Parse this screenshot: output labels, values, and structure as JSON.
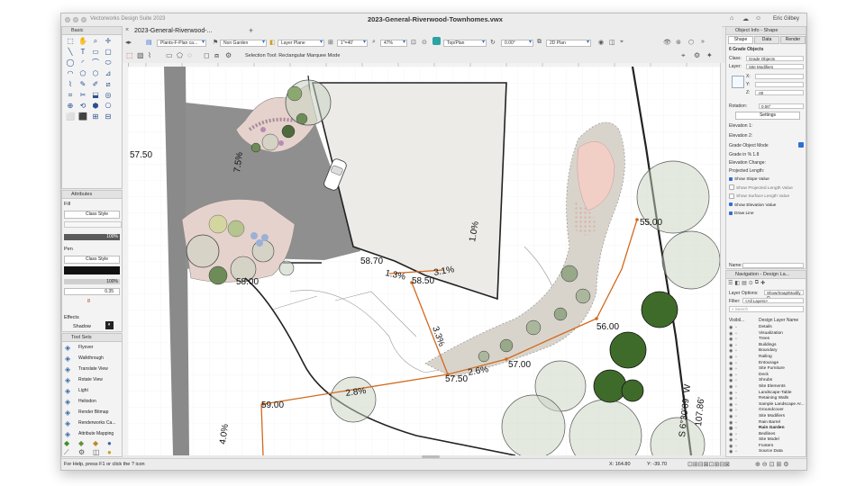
{
  "app": {
    "name": "Vectorworks Design Suite 2023",
    "document_title": "2023-General-Riverwood-Townhomes.vwx",
    "user": "Eric Gilbey",
    "doc_tab": "2023-General-Riverwood-..."
  },
  "toolbar": {
    "view_combo": "Plants-F-Plan ca...",
    "class_combo": "Non Garden",
    "layer_combo": "Layer Plane",
    "scale_combo": "1\"=40'",
    "zoom_combo": "47%",
    "view_mode": "Top/Plan",
    "angle": "0.00°",
    "render_mode": "2D Plan",
    "mode_text": "Selection Tool: Rectangular Marquee Mode"
  },
  "basic_palette": {
    "title": "Basic",
    "tools": [
      "⬚",
      "✋",
      "⌕",
      "✛",
      "╲",
      "T",
      "▭",
      "▢",
      "◯",
      "◜",
      "⌒",
      "⬭",
      "◠",
      "⬠",
      "⬡",
      "⊿",
      "⌇",
      "✎",
      "✐",
      "⧄",
      "⌗",
      "✂",
      "⬓",
      "◎",
      "⊕",
      "⟲",
      "⬢",
      "⎔",
      "⬜",
      "⬛",
      "⊞",
      "⊟"
    ]
  },
  "attributes": {
    "title": "Attributes",
    "fill_label": "Fill",
    "fill_value": "Class Style",
    "fill_opacity": "100%",
    "pen_label": "Pen",
    "pen_value": "Class Style",
    "pen_opacity": "100%",
    "line_weight": "0.35",
    "effects_label": "Effects",
    "shadow_label": "Shadow"
  },
  "tool_sets": {
    "title": "Tool Sets",
    "items": [
      {
        "label": "Flyover",
        "icon": "flyover-icon"
      },
      {
        "label": "Walkthrough",
        "icon": "walkthrough-icon"
      },
      {
        "label": "Translate View",
        "icon": "translate-icon"
      },
      {
        "label": "Rotate View",
        "icon": "rotate-icon"
      },
      {
        "label": "Light",
        "icon": "light-icon"
      },
      {
        "label": "Heliodon",
        "icon": "heliodon-icon"
      },
      {
        "label": "Render Bitmap",
        "icon": "bitmap-icon"
      },
      {
        "label": "Renderworks Ca...",
        "icon": "camera-icon"
      },
      {
        "label": "Attribute Mapping",
        "icon": "mapping-icon"
      }
    ]
  },
  "object_info": {
    "title": "Object Info - Shape",
    "tabs": [
      "Shape",
      "Data",
      "Render"
    ],
    "object_type": "6 Grade Objects",
    "class_label": "Class:",
    "class_value": "Grade Objects",
    "layer_label": "Layer:",
    "layer_value": "Site Modifiers",
    "x_label": "X:",
    "y_label": "Y:",
    "z_label": "Z:",
    "z_value": ".00",
    "rotation_label": "Rotation:",
    "rotation_value": "0.00°",
    "settings_button": "Settings",
    "elevation1": "Elevation 1:",
    "elevation2": "Elevation 2:",
    "grade_mode": "Grade Object Mode",
    "grade_pct": "Grade in % 1.8",
    "elev_change": "Elevation Change:",
    "proj_length": "Projected Length:",
    "checkboxes": [
      {
        "label": "Show Slope Value",
        "checked": true
      },
      {
        "label": "Show Projected Length Value",
        "checked": false
      },
      {
        "label": "Show Surface Length Value",
        "checked": false
      },
      {
        "label": "Show Elevation Value",
        "checked": true
      },
      {
        "label": "Draw Line",
        "checked": true
      }
    ],
    "name_label": "Name:"
  },
  "navigation": {
    "title": "Navigation - Design La...",
    "layer_options_label": "Layer Options:",
    "layer_options_value": "Show/Snap/Modify O...",
    "filter_label": "Filter:",
    "filter_value": "<All Layers>",
    "search_placeholder": "Search",
    "col_visibility": "Visibil...",
    "col_name": "Design Layer Name",
    "layers": [
      "Details",
      "Visualization",
      "Trees",
      "Buildings",
      "Boundary",
      "Railing",
      "Entourage",
      "Site Furniture",
      "Deck",
      "Shrubs",
      "Site Elements",
      "Landscape-Table",
      "Retaining Walls",
      "Sample Landscape Ar...",
      "Groundcover",
      "Site Modifiers",
      "Rain Barrel",
      "Rain Garden",
      "Bedlines",
      "Site Model",
      "Footers",
      "Source Data"
    ]
  },
  "status": {
    "help": "For Help, press F1 or click the ? icon",
    "x": "X: 164.80",
    "y": "Y: -39.70"
  },
  "map_labels": {
    "slope_75": "7.5%",
    "elev_5750": "57.50",
    "slope_10": "1.0%",
    "elev_5870": "58.70",
    "slope_13": "1.3%",
    "elev_5850": "58.50",
    "slope_31": "3.1%",
    "elev_5800": "58.00",
    "slope_33": "3.3%",
    "elev_5750b": "57.50",
    "slope_26": "2.6%",
    "elev_5700": "57.00",
    "elev_5600": "56.00",
    "elev_5500": "55.00",
    "slope_28": "2.8%",
    "elev_5900": "59.00",
    "slope_40": "4.0%",
    "bearing": "S 6°30'09\" W",
    "distance": "107.86'"
  },
  "colors": {
    "accent": "#2f6fd6",
    "grade_line": "#d2691e",
    "building": "#ecebe8",
    "paving": "#8c8c8c",
    "tree_dark": "#3f6b2a",
    "canopy": "#c9d3c2"
  }
}
